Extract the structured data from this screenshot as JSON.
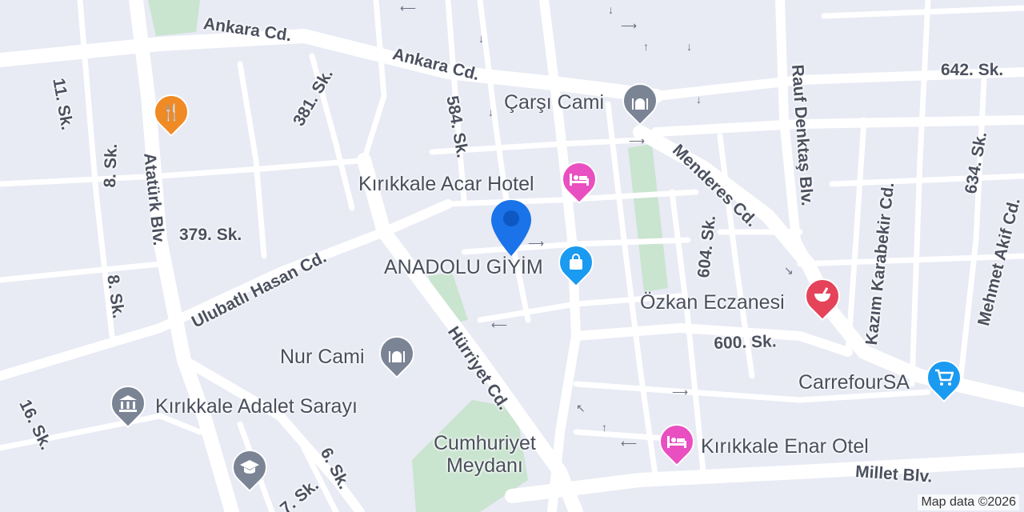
{
  "map": {
    "attribution": "Map data ©2026",
    "streets": {
      "ankara_1": "Ankara Cd.",
      "ankara_2": "Ankara Cd.",
      "sk_11": "11. Sk.",
      "sk_381": "381. Sk.",
      "sk_584": "584. Sk.",
      "sk_8a": "8. Sk.",
      "ataturk": "Atatürk Blv.",
      "sk_379": "379. Sk.",
      "ulubatli": "Ulubatlı Hasan Cd.",
      "sk_8b": "8. Sk.",
      "hurriyet": "Hürriyet Cd.",
      "sk_16": "16. Sk.",
      "sk_6": "6. Sk.",
      "sk_7": "7. Sk.",
      "menderes": "Menderes Cd.",
      "rauf": "Rauf Denktaş Blv.",
      "sk_642": "642. Sk.",
      "sk_634": "634. Sk.",
      "kazim": "Kazım Karabekir Cd.",
      "mehmet": "Mehmet Akif Cd.",
      "sk_604": "604. Sk.",
      "sk_600": "600. Sk.",
      "millet": "Millet Blv."
    },
    "places": {
      "carsi_cami": "Çarşı Cami",
      "acar_hotel": "Kırıkkale Acar Hotel",
      "anadolu": "ANADOLU GİYİM",
      "ozkan": "Özkan Eczanesi",
      "nur_cami": "Nur Cami",
      "carrefour": "CarrefourSA",
      "adalet": "Kırıkkale Adalet Sarayı",
      "cumhuriyet": "Cumhuriyet\nMeydanı",
      "enar": "Kırıkkale Enar Otel"
    },
    "colors": {
      "background": "#e8eaf4",
      "road": "#ffffff",
      "park": "#c9e4cf",
      "restaurant": "#f08a24",
      "mosque": "#7b8494",
      "hotel": "#e94fc0",
      "shopping": "#1a9af0",
      "pharmacy": "#e5435a",
      "location": "#1a73e8"
    },
    "icons": {
      "restaurant": "fork-knife-icon",
      "mosque": "mosque-icon",
      "hotel": "bed-icon",
      "shopping": "shopping-bag-icon",
      "pharmacy": "mortar-pestle-icon",
      "government": "courthouse-icon",
      "school": "graduation-cap-icon",
      "grocery": "shopping-cart-icon"
    }
  }
}
